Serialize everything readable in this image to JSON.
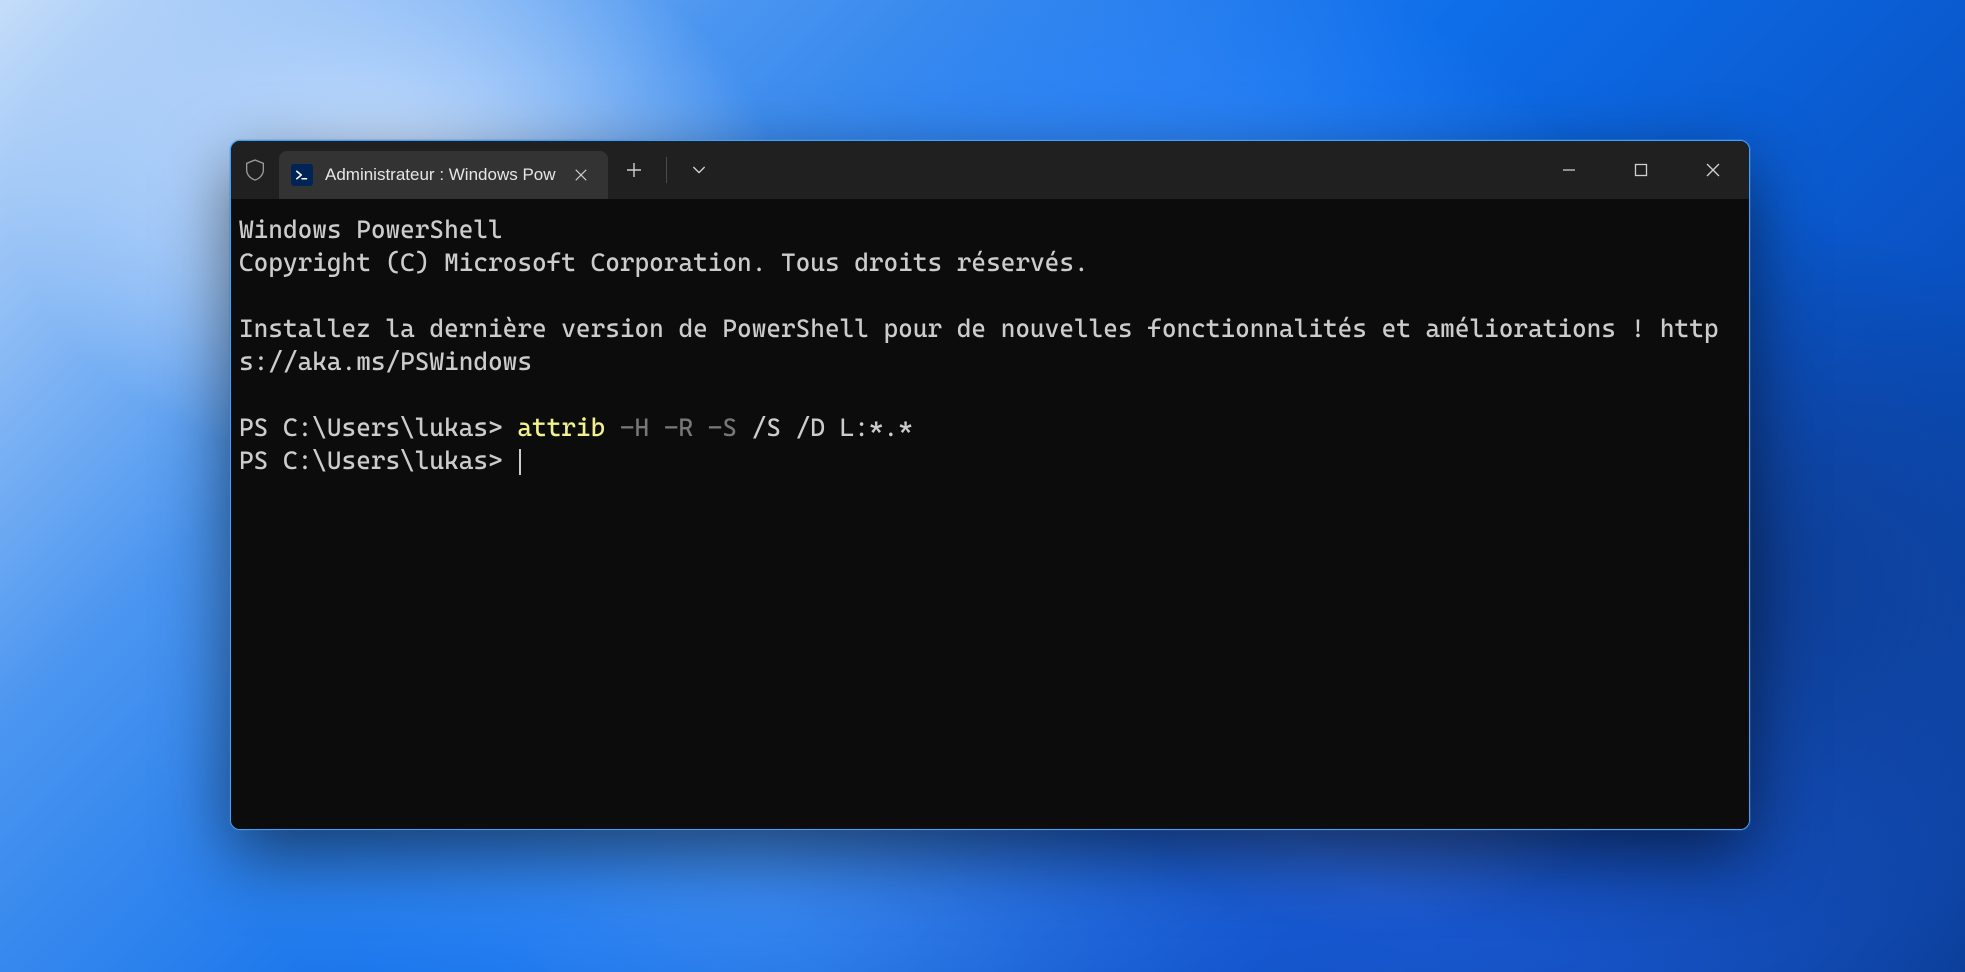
{
  "tab": {
    "title": "Administrateur : Windows Pow",
    "icon_label": ">_"
  },
  "terminal": {
    "line1": "Windows PowerShell",
    "line2": "Copyright (C) Microsoft Corporation. Tous droits réservés.",
    "blank1": "",
    "line3": "Installez la dernière version de PowerShell pour de nouvelles fonctionnalités et améliorations ! https://aka.ms/PSWindows",
    "blank2": "",
    "prompt1_prefix": "PS C:\\Users\\lukas> ",
    "prompt1_cmd": "attrib",
    "prompt1_flags": " -H -R -S",
    "prompt1_rest": " /S /D L:*.*",
    "prompt2_prefix": "PS C:\\Users\\lukas> "
  },
  "titlebar": {
    "new_tab_glyph": "+",
    "dropdown_glyph": "⌄",
    "close_tab_glyph": "✕"
  }
}
